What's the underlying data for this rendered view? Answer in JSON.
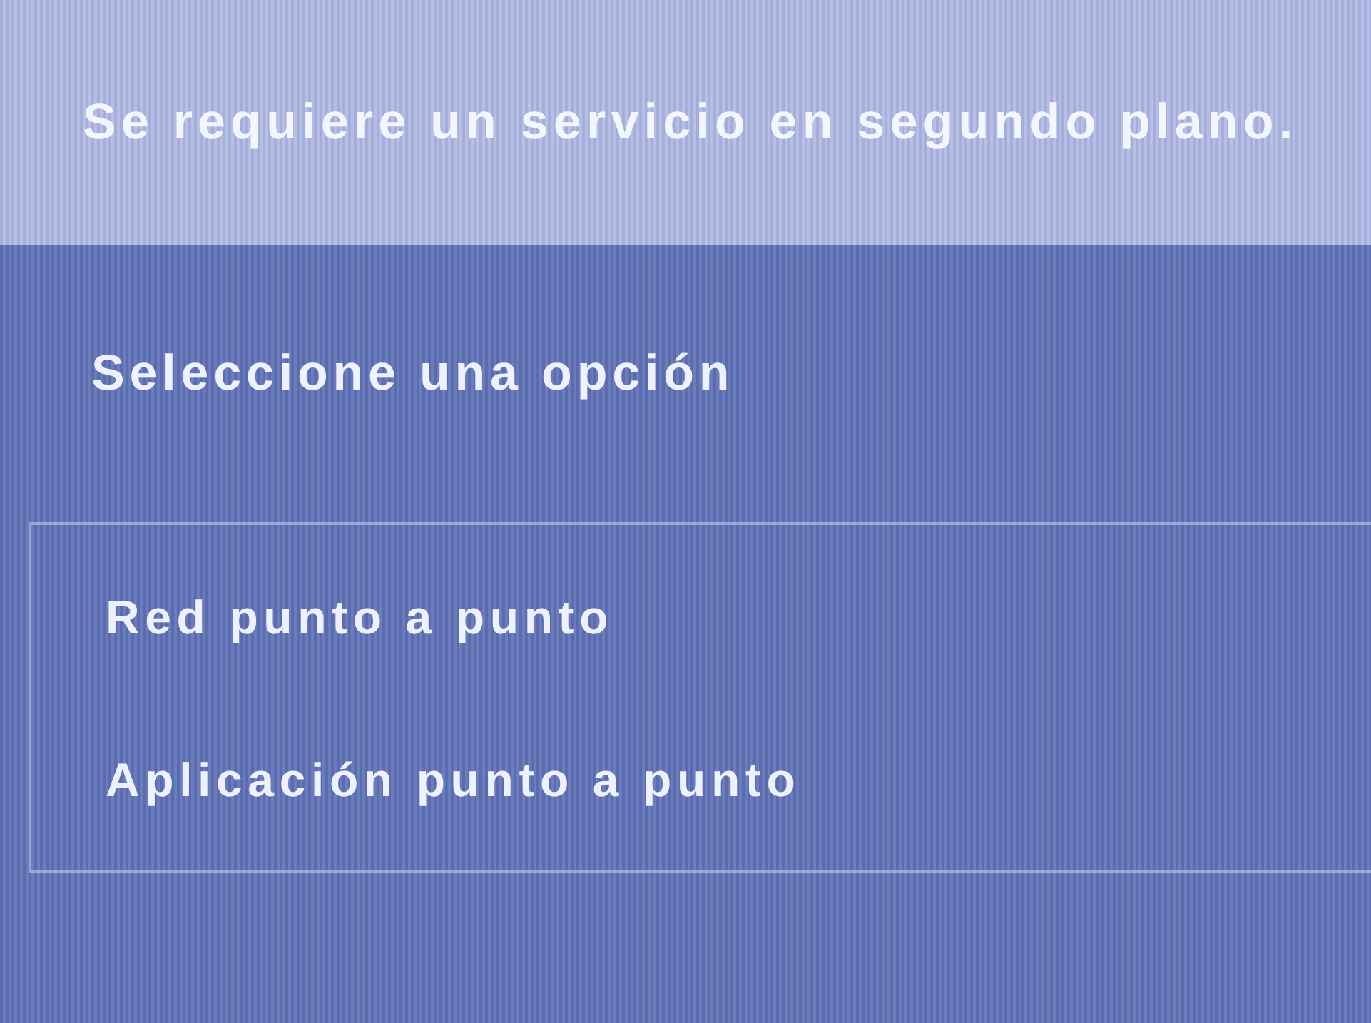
{
  "banner": {
    "message": "Se requiere un servicio en segundo plano."
  },
  "prompt": "Seleccione una opción",
  "options": [
    {
      "label": "Red punto a punto",
      "selected": false
    },
    {
      "label": "Aplicación punto a punto",
      "selected": false
    }
  ]
}
